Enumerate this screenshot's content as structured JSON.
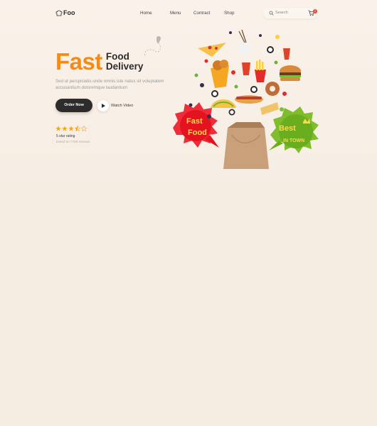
{
  "logo": {
    "text": "Foo"
  },
  "nav": {
    "items": [
      "Home",
      "Menu",
      "Contract",
      "Shop"
    ]
  },
  "search": {
    "placeholder": "Search"
  },
  "cart": {
    "badge": "0"
  },
  "hero": {
    "title_accent": "Fast",
    "title_line1": "Food",
    "title_line2": "Delivery",
    "description": "Sed ut perspiciatis unde omnis iste natus sit voluptatem accusantium doloremque laudantium",
    "order_button": "Order Now",
    "watch_video": "Watch Video",
    "rating_label": "5 star rating",
    "rating_value": 4.5,
    "reviews": "based on 7788 reviews"
  },
  "illustration": {
    "badge_left_line1": "Fast",
    "badge_left_line2": "Food",
    "badge_right_line1": "Best",
    "badge_right_line2": "IN TOWN"
  },
  "colors": {
    "accent": "#f68a12",
    "dark_button": "#2d2b2b",
    "background": "#f5ece2",
    "star": "#f6a623"
  }
}
